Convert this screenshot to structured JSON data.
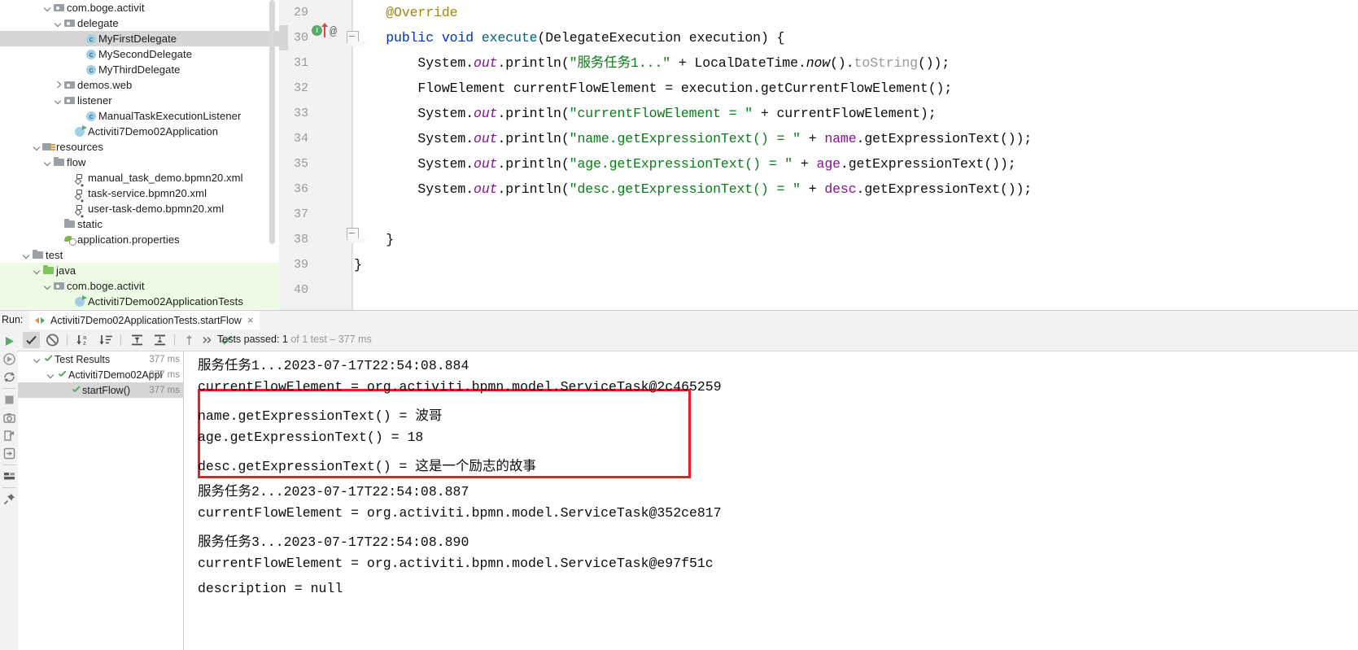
{
  "project_tree": {
    "name": "project-tree",
    "items": [
      {
        "label": "com.boge.activit",
        "indent": 4,
        "twisty": "down",
        "icon": "package-icon",
        "state": "normal"
      },
      {
        "label": "delegate",
        "indent": 5,
        "twisty": "down",
        "icon": "package-icon",
        "state": "normal"
      },
      {
        "label": "MyFirstDelegate",
        "indent": 7,
        "twisty": "none",
        "icon": "java-class-icon",
        "state": "selected"
      },
      {
        "label": "MySecondDelegate",
        "indent": 7,
        "twisty": "none",
        "icon": "java-class-icon",
        "state": "normal"
      },
      {
        "label": "MyThirdDelegate",
        "indent": 7,
        "twisty": "none",
        "icon": "java-class-icon",
        "state": "normal"
      },
      {
        "label": "demos.web",
        "indent": 5,
        "twisty": "right",
        "icon": "package-icon",
        "state": "normal"
      },
      {
        "label": "listener",
        "indent": 5,
        "twisty": "down",
        "icon": "package-icon",
        "state": "normal"
      },
      {
        "label": "ManualTaskExecutionListener",
        "indent": 7,
        "twisty": "none",
        "icon": "java-class-icon",
        "state": "normal"
      },
      {
        "label": "Activiti7Demo02Application",
        "indent": 6,
        "twisty": "none",
        "icon": "java-class-runnable-icon",
        "state": "normal"
      },
      {
        "label": "resources",
        "indent": 3,
        "twisty": "down",
        "icon": "resources-folder-icon",
        "state": "normal"
      },
      {
        "label": "flow",
        "indent": 4,
        "twisty": "down",
        "icon": "folder-icon",
        "state": "normal"
      },
      {
        "label": "manual_task_demo.bpmn20.xml",
        "indent": 6,
        "twisty": "none",
        "icon": "bpmn-file-icon",
        "state": "normal"
      },
      {
        "label": "task-service.bpmn20.xml",
        "indent": 6,
        "twisty": "none",
        "icon": "bpmn-file-icon",
        "state": "normal"
      },
      {
        "label": "user-task-demo.bpmn20.xml",
        "indent": 6,
        "twisty": "none",
        "icon": "bpmn-file-icon",
        "state": "normal"
      },
      {
        "label": "static",
        "indent": 5,
        "twisty": "none",
        "icon": "folder-icon",
        "state": "normal"
      },
      {
        "label": "application.properties",
        "indent": 5,
        "twisty": "none",
        "icon": "properties-file-icon",
        "state": "normal"
      },
      {
        "label": "test",
        "indent": 2,
        "twisty": "down",
        "icon": "folder-icon",
        "state": "normal"
      },
      {
        "label": "java",
        "indent": 3,
        "twisty": "down",
        "icon": "source-folder-icon",
        "state": "highlighted"
      },
      {
        "label": "com.boge.activit",
        "indent": 4,
        "twisty": "down",
        "icon": "package-icon",
        "state": "highlighted"
      },
      {
        "label": "Activiti7Demo02ApplicationTests",
        "indent": 6,
        "twisty": "none",
        "icon": "java-class-runnable-icon",
        "state": "highlighted"
      }
    ]
  },
  "editor": {
    "name": "code-editor",
    "lines": [
      {
        "num": "29",
        "text": "    @Override"
      },
      {
        "num": "30",
        "text": "    public void execute(DelegateExecution execution) {"
      },
      {
        "num": "31",
        "text": "        System.out.println(\"服务任务1...\" + LocalDateTime.now().toString());"
      },
      {
        "num": "32",
        "text": "        FlowElement currentFlowElement = execution.getCurrentFlowElement();"
      },
      {
        "num": "33",
        "text": "        System.out.println(\"currentFlowElement = \" + currentFlowElement);"
      },
      {
        "num": "34",
        "text": "        System.out.println(\"name.getExpressionText() = \" + name.getExpressionText());"
      },
      {
        "num": "35",
        "text": "        System.out.println(\"age.getExpressionText() = \" + age.getExpressionText());"
      },
      {
        "num": "36",
        "text": "        System.out.println(\"desc.getExpressionText() = \" + desc.getExpressionText());"
      },
      {
        "num": "37",
        "text": ""
      },
      {
        "num": "38",
        "text": "    }"
      },
      {
        "num": "39",
        "text": "}"
      },
      {
        "num": "40",
        "text": ""
      }
    ],
    "gutter_markers": {
      "line": "30",
      "run_icon": "run-test-gutter-icon",
      "override_icon": "override-method-icon",
      "annotation_icon": "@"
    }
  },
  "run_window": {
    "label": "Run:",
    "tab": {
      "title": "Activiti7Demo02ApplicationTests.startFlow",
      "close": "×",
      "icon": "rerun-tab-icon"
    },
    "toolbar": {
      "buttons": [
        {
          "name": "rerun-button",
          "icon": "play-icon"
        },
        {
          "name": "show-passed-button",
          "icon": "checkmark-icon",
          "active": true
        },
        {
          "name": "show-ignored-button",
          "icon": "no-entry-icon",
          "active": false
        },
        {
          "name": "sort-alphabetically-button",
          "icon": "sort-az-icon"
        },
        {
          "name": "sort-by-duration-button",
          "icon": "sort-duration-icon"
        },
        {
          "name": "expand-all-button",
          "icon": "expand-all-icon"
        },
        {
          "name": "collapse-all-button",
          "icon": "collapse-all-icon"
        },
        {
          "name": "previous-occurrence-button",
          "icon": "arrow-up-icon"
        },
        {
          "name": "more-options-button",
          "icon": "chevron-double-right-icon"
        }
      ],
      "status": {
        "prefix": "Tests passed: ",
        "count": "1",
        "suffix": " of 1 test – 377 ms"
      }
    },
    "side_buttons": [
      {
        "name": "rerun-side-button",
        "icon": "green-play-icon"
      },
      {
        "name": "rerun-failed-side-button",
        "icon": "rerun-failed-icon"
      },
      {
        "name": "toggle-auto-test-side-button",
        "icon": "auto-test-icon"
      },
      {
        "name": "stop-side-button",
        "icon": "stop-square-icon"
      },
      {
        "name": "export-side-button",
        "icon": "camera-icon"
      },
      {
        "name": "import-side-button",
        "icon": "import-icon"
      },
      {
        "name": "open-side-button",
        "icon": "open-arrow-icon"
      },
      {
        "name": "layout-side-button",
        "icon": "layout-icon"
      },
      {
        "name": "pin-side-button",
        "icon": "pin-icon"
      }
    ],
    "test_tree": [
      {
        "label": "Test Results",
        "time": "377 ms",
        "indent": 1,
        "twisty": "down",
        "state": "normal"
      },
      {
        "label": "Activiti7Demo02Appl",
        "time": "377 ms",
        "indent": 2,
        "twisty": "down",
        "state": "normal"
      },
      {
        "label": "startFlow()",
        "time": "377 ms",
        "indent": 3,
        "twisty": "none",
        "state": "selected"
      }
    ],
    "console_lines": [
      "服务任务1...2023-07-17T22:54:08.884",
      "currentFlowElement = org.activiti.bpmn.model.ServiceTask@2c465259",
      "name.getExpressionText() = 波哥",
      "age.getExpressionText() = 18",
      "desc.getExpressionText() = 这是一个励志的故事",
      "服务任务2...2023-07-17T22:54:08.887",
      "currentFlowElement = org.activiti.bpmn.model.ServiceTask@352ce817",
      "服务任务3...2023-07-17T22:54:08.890",
      "currentFlowElement = org.activiti.bpmn.model.ServiceTask@e97f51c",
      "description = null"
    ],
    "highlight_box": {
      "name": "red-annotation-box",
      "color": "#ee1c25"
    }
  }
}
